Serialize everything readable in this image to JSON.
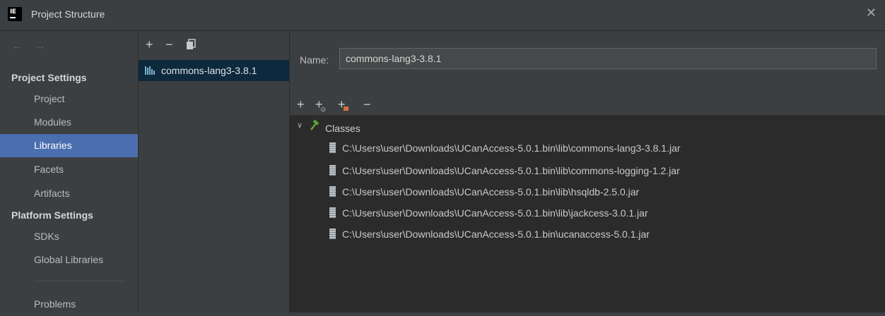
{
  "window": {
    "title": "Project Structure",
    "close_icon": "close-icon"
  },
  "sidebar": {
    "nav_arrows": "← →",
    "sections": [
      {
        "title": "Project Settings",
        "items": [
          {
            "label": "Project"
          },
          {
            "label": "Modules"
          },
          {
            "label": "Libraries",
            "selected": true
          },
          {
            "label": "Facets"
          },
          {
            "label": "Artifacts"
          }
        ]
      },
      {
        "title": "Platform Settings",
        "items": [
          {
            "label": "SDKs"
          },
          {
            "label": "Global Libraries"
          }
        ]
      }
    ],
    "problems_label": "Problems"
  },
  "library_list": {
    "toolbar": {
      "add": "+",
      "remove": "−",
      "copy_icon": "copy-icon"
    },
    "items": [
      {
        "label": "commons-lang3-3.8.1",
        "selected": true
      }
    ]
  },
  "detail": {
    "name_label": "Name:",
    "name_value": "commons-lang3-3.8.1",
    "toolbar": {
      "add": "+",
      "add_url": "+",
      "add_jar": "+",
      "remove": "−"
    },
    "tree": {
      "root_label": "Classes",
      "expanded": true,
      "entries": [
        "C:\\Users\\user\\Downloads\\UCanAccess-5.0.1.bin\\lib\\commons-lang3-3.8.1.jar",
        "C:\\Users\\user\\Downloads\\UCanAccess-5.0.1.bin\\lib\\commons-logging-1.2.jar",
        "C:\\Users\\user\\Downloads\\UCanAccess-5.0.1.bin\\lib\\hsqldb-2.5.0.jar",
        "C:\\Users\\user\\Downloads\\UCanAccess-5.0.1.bin\\lib\\jackcess-3.0.1.jar",
        "C:\\Users\\user\\Downloads\\UCanAccess-5.0.1.bin\\ucanaccess-5.0.1.jar"
      ]
    }
  },
  "colors": {
    "background": "#3c3f41",
    "tree_background": "#2b2b2b",
    "selection": "#4b6eaf",
    "list_selection": "#0d293e"
  }
}
